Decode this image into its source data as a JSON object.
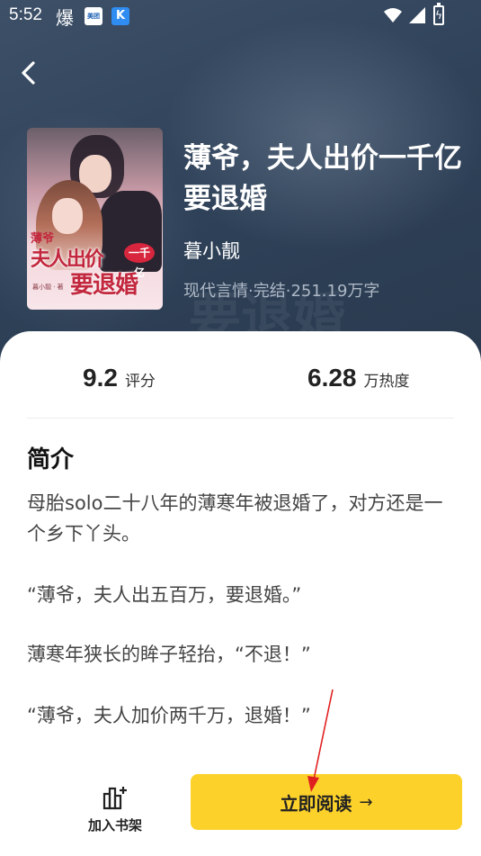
{
  "status_bar": {
    "time": "5:52",
    "app_char": "爆",
    "app1_label": "美团",
    "app2_label": "K"
  },
  "book": {
    "title": "薄爷，夫人出价一千亿要退婚",
    "author": "暮小靓",
    "meta": "现代言情·完结·251.19万字",
    "cover": {
      "line1": "薄爷",
      "line2": "夫人出价",
      "badge": "一千亿",
      "line3": "要退婚",
      "credit": "暮小靓 · 著"
    }
  },
  "stats": {
    "rating_value": "9.2",
    "rating_label": "评分",
    "heat_value": "6.28",
    "heat_label": "万热度"
  },
  "intro": {
    "heading": "简介",
    "paragraphs": [
      "母胎solo二十八年的薄寒年被退婚了，对方还是一个乡下丫头。",
      "“薄爷，夫人出五百万，要退婚。”",
      "薄寒年狭长的眸子轻抬，“不退！”",
      "“薄爷，夫人加价两千万，退婚！”"
    ]
  },
  "bottom_bar": {
    "shelf_label": "加入书架",
    "read_label": "立即阅读",
    "read_arrow": "→"
  },
  "colors": {
    "header_bg": "#2f4259",
    "primary_button": "#fcd12a",
    "annotation_arrow": "#e02020"
  }
}
